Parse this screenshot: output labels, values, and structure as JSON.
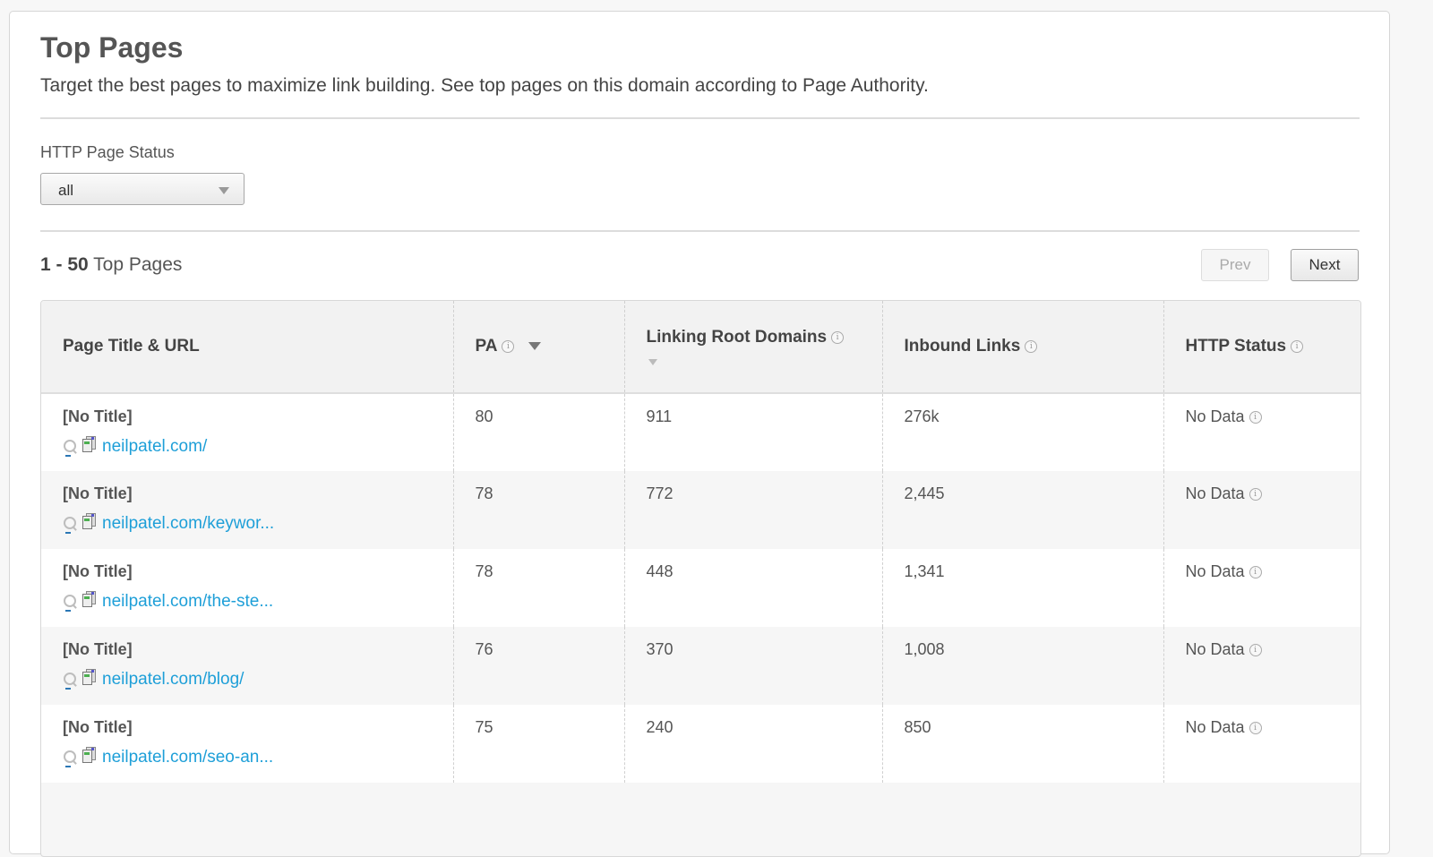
{
  "header": {
    "title": "Top Pages",
    "subtitle": "Target the best pages to maximize link building. See top pages on this domain according to Page Authority."
  },
  "filter": {
    "label": "HTTP Page Status",
    "selected": "all"
  },
  "results": {
    "range": "1 - 50",
    "label": "Top Pages",
    "prev_label": "Prev",
    "next_label": "Next"
  },
  "table": {
    "columns": [
      {
        "label": "Page Title & URL"
      },
      {
        "label": "PA"
      },
      {
        "label": "Linking Root Domains"
      },
      {
        "label": "Inbound Links"
      },
      {
        "label": "HTTP Status"
      }
    ],
    "rows": [
      {
        "title": "[No Title]",
        "url": "neilpatel.com/",
        "pa": "80",
        "lrd": "911",
        "inbound": "276k",
        "status": "No Data"
      },
      {
        "title": "[No Title]",
        "url": "neilpatel.com/keywor...",
        "pa": "78",
        "lrd": "772",
        "inbound": "2,445",
        "status": "No Data"
      },
      {
        "title": "[No Title]",
        "url": "neilpatel.com/the-ste...",
        "pa": "78",
        "lrd": "448",
        "inbound": "1,341",
        "status": "No Data"
      },
      {
        "title": "[No Title]",
        "url": "neilpatel.com/blog/",
        "pa": "76",
        "lrd": "370",
        "inbound": "1,008",
        "status": "No Data"
      },
      {
        "title": "[No Title]",
        "url": "neilpatel.com/seo-an...",
        "pa": "75",
        "lrd": "240",
        "inbound": "850",
        "status": "No Data"
      }
    ]
  },
  "icons": {
    "info": "i",
    "sort": "sort-desc-arrow",
    "search": "magnifier",
    "page": "page-preview"
  },
  "colors": {
    "link": "#1e9fd8",
    "text": "#555555",
    "header_bg": "#f2f2f2"
  }
}
